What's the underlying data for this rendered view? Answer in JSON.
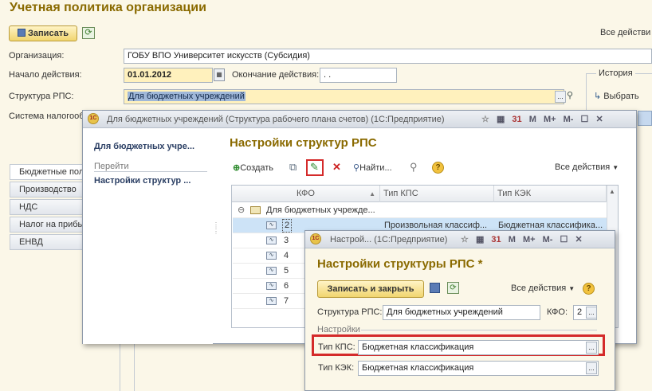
{
  "main": {
    "title": "Учетная политика организации",
    "save_label": "Записать",
    "all_actions": "Все действи",
    "org_label": "Организация:",
    "org_value": "ГОБУ ВПО Университет искусств (Субсидия)",
    "start_label": "Начало действия:",
    "start_value": "01.01.2012",
    "end_label": "Окончание действия:",
    "end_value": ". .",
    "rps_label": "Структура РПС:",
    "rps_value": "Для бюджетных учреждений",
    "tax_label": "Система налогооб",
    "history_label": "История",
    "select_label": "Выбрать",
    "tabs": [
      "Бюджетные пол",
      "Производство",
      "НДС",
      "Налог на прибы",
      "ЕНВД"
    ]
  },
  "win1": {
    "title": "Для бюджетных учреждений (Структура рабочего плана счетов) (1С:Предприятие)",
    "tb_icons": [
      "M",
      "M+",
      "M-"
    ],
    "nav_title": "Для бюджетных учре...",
    "nav_go": "Перейти",
    "nav_item": "Настройки структур ...",
    "heading": "Настройки структур РПС",
    "create_label": "Создать",
    "find_label": "Найти...",
    "all_actions": "Все действия",
    "columns": [
      "КФО",
      "Тип КПС",
      "Тип КЭК"
    ],
    "group_row": "Для бюджетных учрежде...",
    "rows": [
      {
        "kfo": "2",
        "kps": "Произвольная классиф...",
        "kek": "Бюджетная классифика..."
      },
      {
        "kfo": "3",
        "kps": "",
        "kek": ""
      },
      {
        "kfo": "4",
        "kps": "",
        "kek": ""
      },
      {
        "kfo": "5",
        "kps": "",
        "kek": ""
      },
      {
        "kfo": "6",
        "kps": "",
        "kek": ""
      },
      {
        "kfo": "7",
        "kps": "",
        "kek": ""
      }
    ]
  },
  "win2": {
    "title": "Настрой... (1С:Предприятие)",
    "tb_icons": [
      "M",
      "M+",
      "M-"
    ],
    "heading": "Настройки структуры РПС *",
    "save_close_label": "Записать и закрыть",
    "all_actions": "Все действия",
    "rps_label": "Структура РПС:",
    "rps_value": "Для бюджетных учреждений",
    "kfo_label": "КФО:",
    "kfo_value": "2",
    "settings_label": "Настройки",
    "kps_label": "Тип КПС:",
    "kps_value": "Бюджетная классификация",
    "kek_label": "Тип КЭК:",
    "kek_value": "Бюджетная классификация"
  },
  "colors": {
    "accent_gold": "#8a6a00",
    "highlight_red": "#d42a2a",
    "selection_blue": "#cde3f7"
  }
}
